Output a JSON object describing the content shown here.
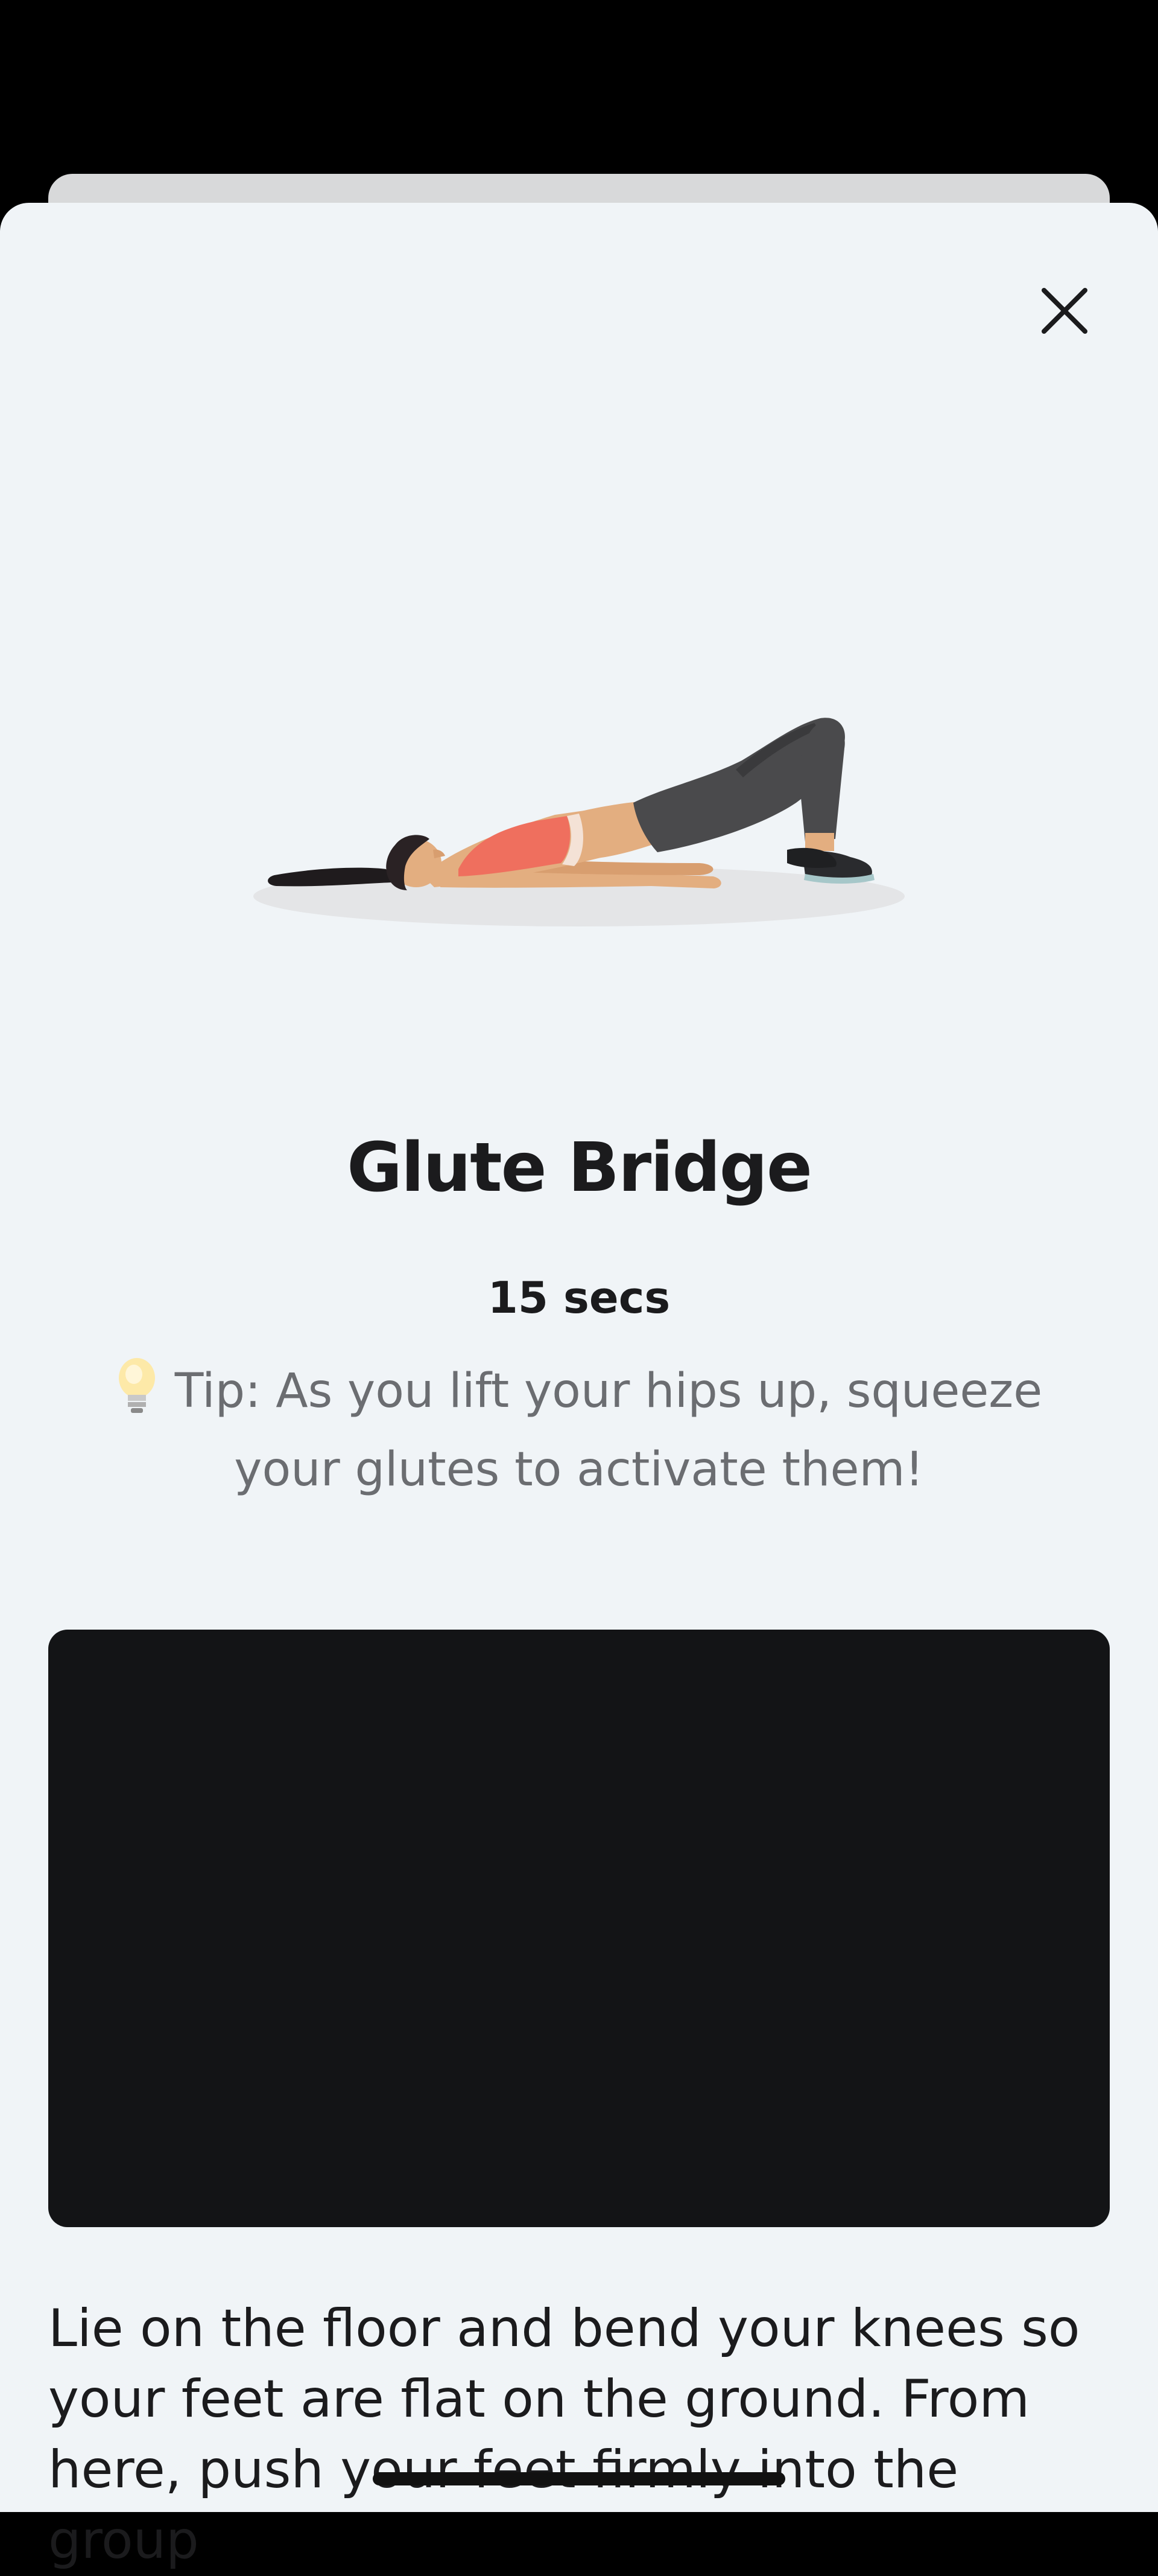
{
  "sheet": {
    "close_icon": "close-icon",
    "illustration": "glute-bridge-illustration"
  },
  "exercise": {
    "name": "Glute Bridge",
    "duration": "15 secs",
    "tip_icon": "lightbulb-icon",
    "tip": "Tip: As you lift your hips up, squeeze your glutes to activate them!",
    "video": "video-player",
    "description": "Lie on the floor and bend your knees so your feet are flat on the ground. From here, push your feet firmly into the group"
  },
  "colors": {
    "sheet_background": "#f0f4f7",
    "text_primary": "#1b1b1d",
    "text_secondary": "#6b6d71",
    "video_background": "#131416"
  }
}
